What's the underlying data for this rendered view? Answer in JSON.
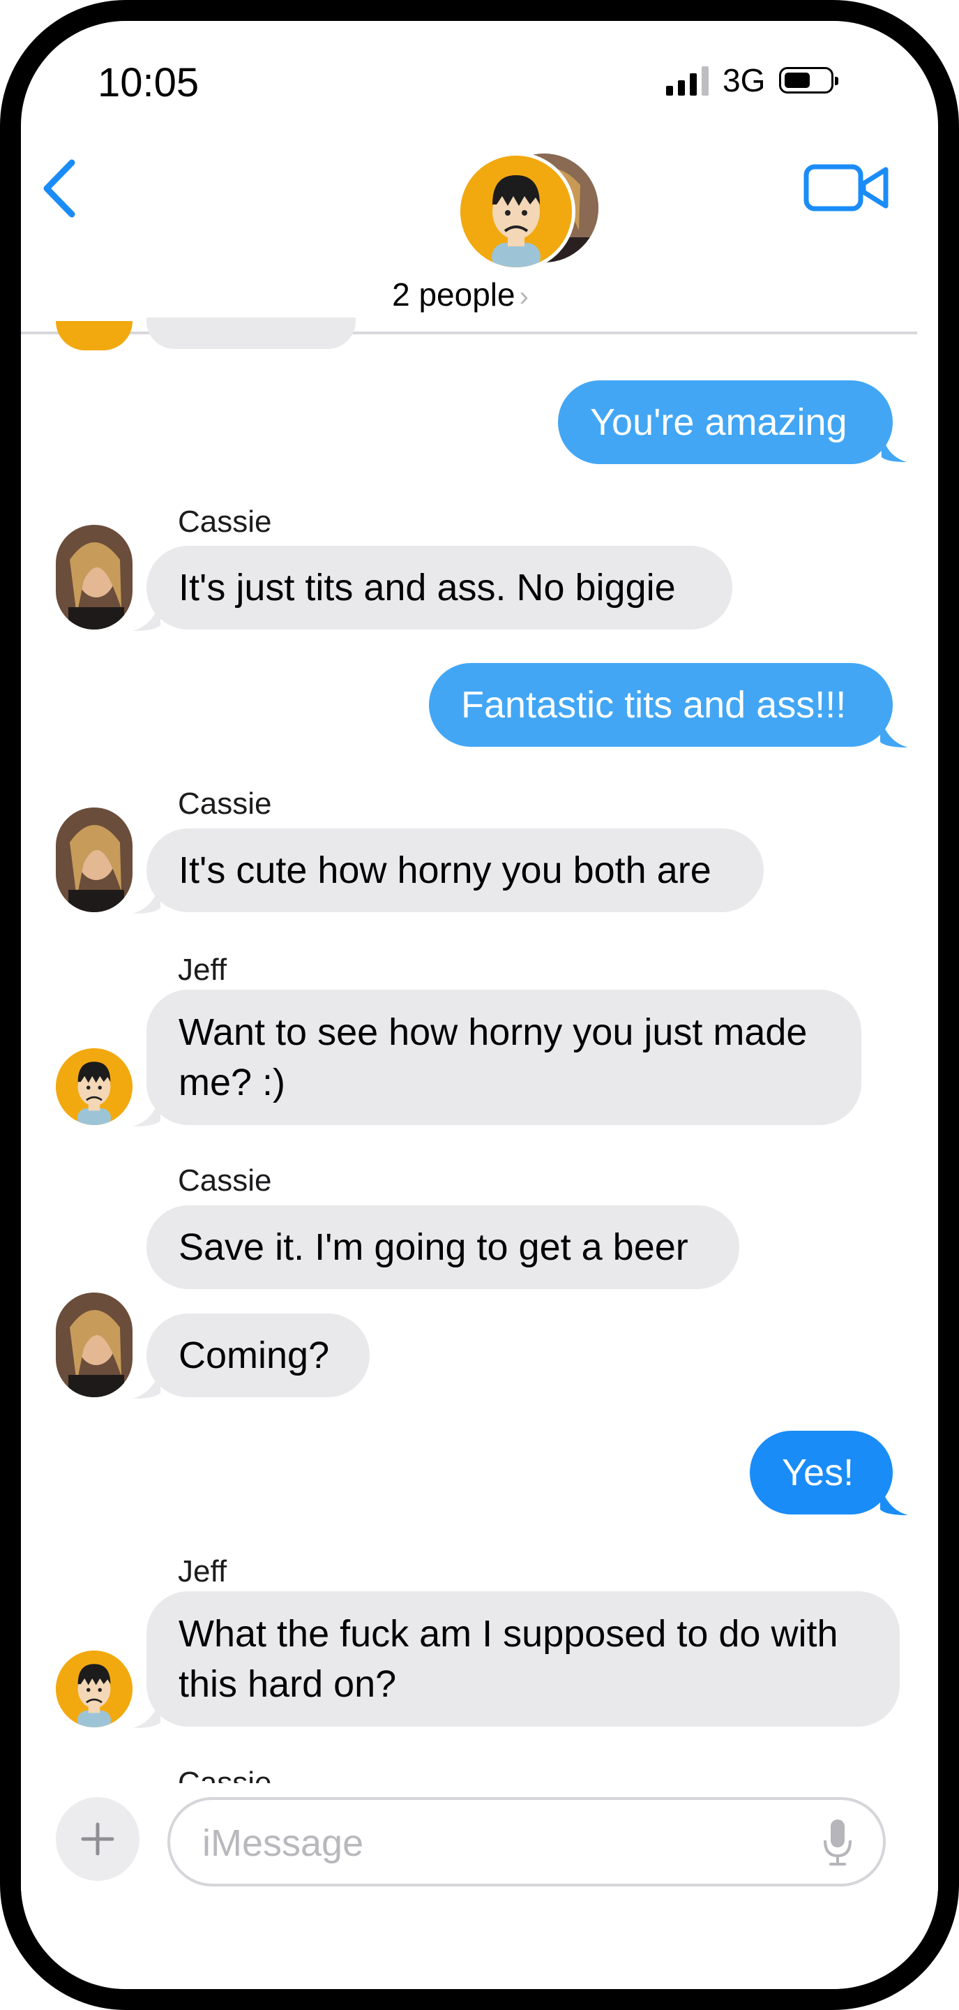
{
  "status_bar": {
    "time": "10:05",
    "network": "3G"
  },
  "header": {
    "title": "2 people",
    "chevron": "›"
  },
  "messages": [
    {
      "side": "sent",
      "text": "You're amazing"
    },
    {
      "side": "received",
      "sender": "Cassie",
      "text": "It's just tits and ass.  No biggie"
    },
    {
      "side": "sent",
      "text": "Fantastic tits and ass!!!"
    },
    {
      "side": "received",
      "sender": "Cassie",
      "text": "It's cute how horny you both are"
    },
    {
      "side": "received",
      "sender": "Jeff",
      "text": "Want to see how horny you just made me? :)"
    },
    {
      "side": "received",
      "sender": "Cassie",
      "text": "Save it.  I'm going to get a beer"
    },
    {
      "side": "received",
      "text": "Coming?"
    },
    {
      "side": "sent",
      "text": "Yes!"
    },
    {
      "side": "received",
      "sender": "Jeff",
      "text": "What the fuck am I supposed to do with this hard on?"
    },
    {
      "side": "received",
      "sender": "Cassie",
      "text": ""
    }
  ],
  "composer": {
    "placeholder": "iMessage"
  },
  "colors": {
    "accent": "#1a8cf7",
    "sent_bubble": "#42a6f5",
    "received_bubble": "#e9e9eb",
    "jeff_avatar": "#f2a90f"
  },
  "icons": {
    "back": "chevron-left-icon",
    "video": "video-camera-icon",
    "plus": "plus-icon",
    "mic": "microphone-icon"
  }
}
